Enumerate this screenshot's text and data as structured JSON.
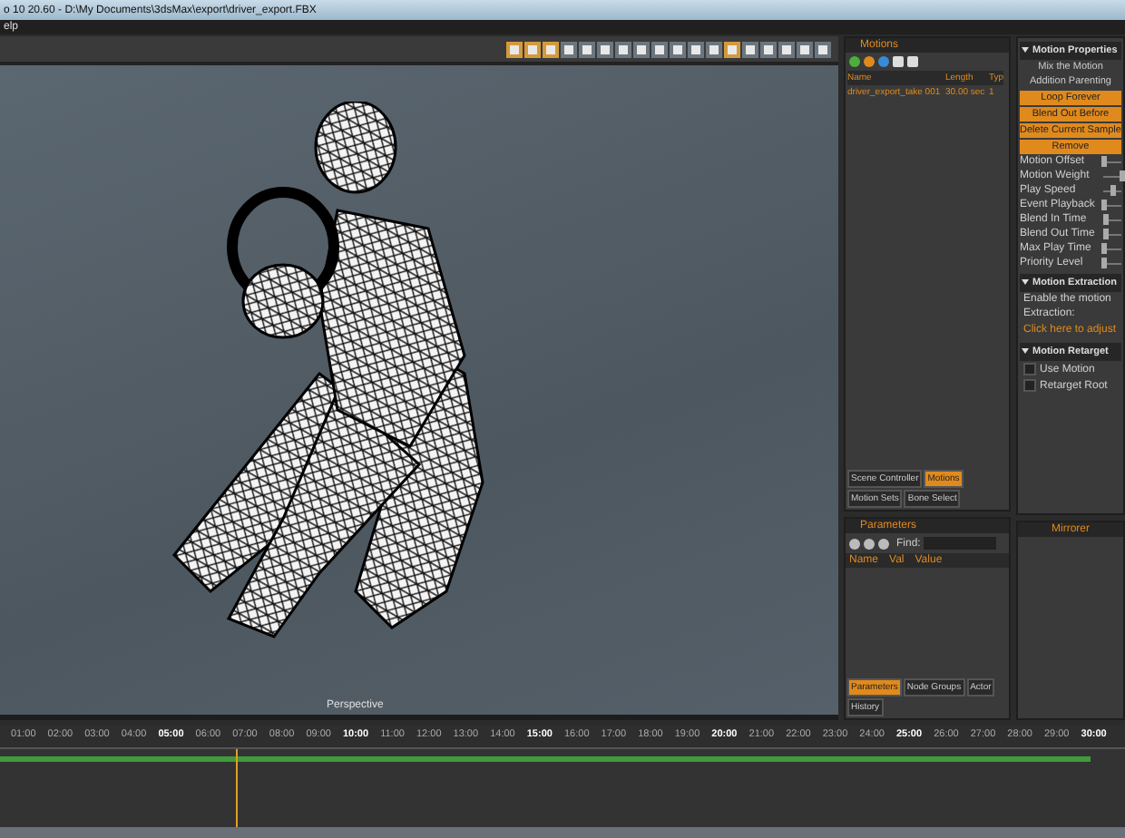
{
  "window": {
    "title": "o 10 20.60 - D:\\My Documents\\3dsMax\\export\\driver_export.FBX"
  },
  "menu": [
    "elp"
  ],
  "toolbar": [
    {
      "selected": true
    },
    {
      "selected": true
    },
    {
      "selected": true
    },
    {
      "selected": false
    },
    {
      "selected": false
    },
    {
      "selected": false
    },
    {
      "selected": false
    },
    {
      "selected": false
    },
    {
      "selected": false
    },
    {
      "selected": false
    },
    {
      "selected": false
    },
    {
      "selected": false
    },
    {
      "selected": true
    },
    {
      "selected": false
    },
    {
      "selected": false
    },
    {
      "selected": false
    },
    {
      "selected": false
    },
    {
      "selected": false
    }
  ],
  "viewport": {
    "label": "Perspective"
  },
  "motions_panel": {
    "title": "Motions",
    "columns": [
      "Name",
      "Length",
      "Typ"
    ],
    "rows": [
      [
        "driver_export_take 001",
        "30.00 sec",
        "1"
      ]
    ],
    "tabs": [
      {
        "label": "Scene Controller",
        "selected": false
      },
      {
        "label": "Motions",
        "selected": true
      },
      {
        "label": "Motion Sets",
        "selected": false
      },
      {
        "label": "Bone Select",
        "selected": false
      }
    ]
  },
  "parameters_panel": {
    "title": "Parameters",
    "search_label": "Find:",
    "columns": [
      "Name",
      "Val",
      "Value"
    ],
    "tabs": [
      {
        "label": "Parameters",
        "selected": true
      },
      {
        "label": "Node Groups",
        "selected": false
      },
      {
        "label": "Actor",
        "selected": false
      },
      {
        "label": "History",
        "selected": false
      }
    ]
  },
  "motion_properties": {
    "title": "Motion Properties",
    "buttons": [
      {
        "label": "Mix the Motion",
        "highlighted": false
      },
      {
        "label": "Addition Parenting",
        "highlighted": false
      },
      {
        "label": "Loop Forever",
        "highlighted": true
      },
      {
        "label": "Blend Out Before",
        "highlighted": true
      },
      {
        "label": "Delete Current Sample",
        "highlighted": true
      },
      {
        "label": "Remove",
        "highlighted": true
      }
    ],
    "sliders": [
      {
        "label": "Motion Offset",
        "level": 0
      },
      {
        "label": "Motion Weight",
        "level": 1
      },
      {
        "label": "Play Speed",
        "level": 0.5
      },
      {
        "label": "Event Playback",
        "level": 0
      },
      {
        "label": "Blend In Time",
        "level": 0.1
      },
      {
        "label": "Blend Out Time",
        "level": 0.1
      },
      {
        "label": "Max Play Time",
        "level": 0
      },
      {
        "label": "Priority Level",
        "level": 0
      }
    ]
  },
  "motion_extraction": {
    "title": "Motion Extraction",
    "text": "Enable the motion",
    "text2": "Extraction:",
    "link": "Click here to adjust"
  },
  "motion_retargeting": {
    "title": "Motion Retarget",
    "options": [
      {
        "label": "Use Motion",
        "checked": false
      },
      {
        "label": "Retarget Root",
        "checked": false
      }
    ]
  },
  "mirror_panel": {
    "title": "Mirrorer"
  },
  "timeline": {
    "playhead": {
      "level": 0.21
    },
    "ticks": [
      {
        "label": "01:00",
        "major": false
      },
      {
        "label": "02:00",
        "major": false
      },
      {
        "label": "03:00",
        "major": false
      },
      {
        "label": "04:00",
        "major": false
      },
      {
        "label": "05:00",
        "major": true
      },
      {
        "label": "06:00",
        "major": false
      },
      {
        "label": "07:00",
        "major": false
      },
      {
        "label": "08:00",
        "major": false
      },
      {
        "label": "09:00",
        "major": false
      },
      {
        "label": "10:00",
        "major": true
      },
      {
        "label": "11:00",
        "major": false
      },
      {
        "label": "12:00",
        "major": false
      },
      {
        "label": "13:00",
        "major": false
      },
      {
        "label": "14:00",
        "major": false
      },
      {
        "label": "15:00",
        "major": true
      },
      {
        "label": "16:00",
        "major": false
      },
      {
        "label": "17:00",
        "major": false
      },
      {
        "label": "18:00",
        "major": false
      },
      {
        "label": "19:00",
        "major": false
      },
      {
        "label": "20:00",
        "major": true
      },
      {
        "label": "21:00",
        "major": false
      },
      {
        "label": "22:00",
        "major": false
      },
      {
        "label": "23:00",
        "major": false
      },
      {
        "label": "24:00",
        "major": false
      },
      {
        "label": "25:00",
        "major": true
      },
      {
        "label": "26:00",
        "major": false
      },
      {
        "label": "27:00",
        "major": false
      },
      {
        "label": "28:00",
        "major": false
      },
      {
        "label": "29:00",
        "major": false
      },
      {
        "label": "30:00",
        "major": true
      }
    ]
  }
}
